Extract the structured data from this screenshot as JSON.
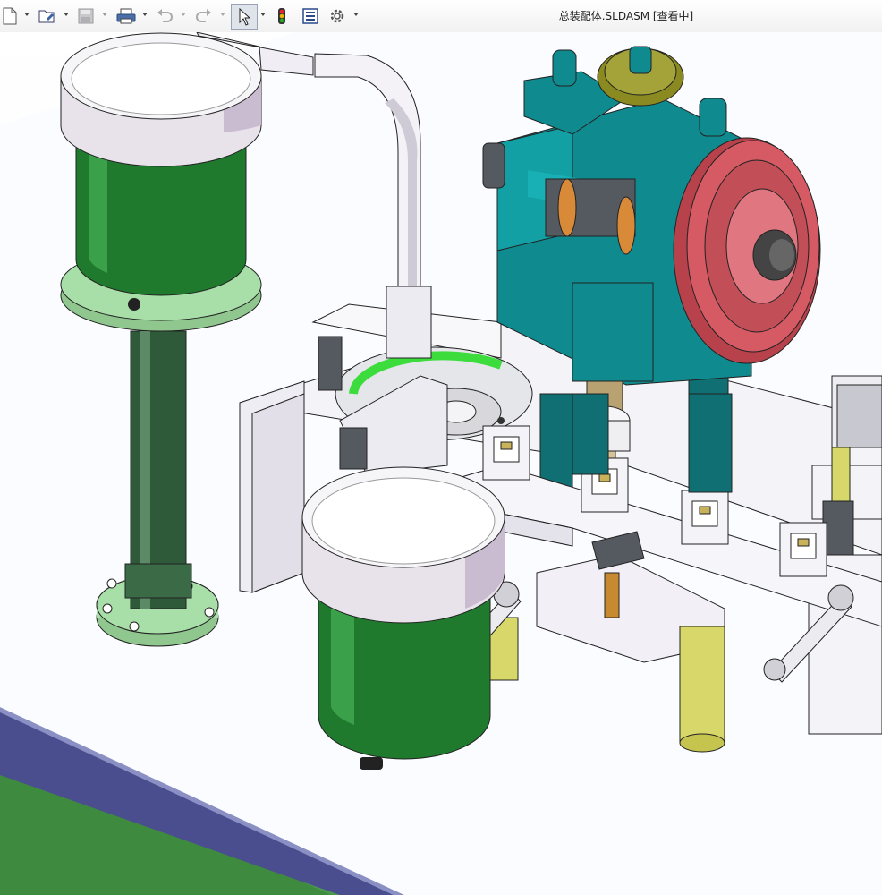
{
  "window": {
    "title": "总装配体.SLDASM [查看中]"
  },
  "toolbar": {
    "items": [
      {
        "name": "new-document",
        "icon": "new-document-icon",
        "has_dropdown": true
      },
      {
        "name": "open",
        "icon": "open-folder-icon",
        "has_dropdown": true
      },
      {
        "name": "save",
        "icon": "save-icon",
        "has_dropdown": true,
        "disabled": true
      },
      {
        "name": "print",
        "icon": "print-icon",
        "has_dropdown": true
      },
      {
        "name": "undo",
        "icon": "undo-icon",
        "has_dropdown": true,
        "disabled": true
      },
      {
        "name": "redo",
        "icon": "redo-icon",
        "has_dropdown": true,
        "disabled": true
      },
      {
        "name": "select",
        "icon": "select-pointer-icon",
        "has_dropdown": true,
        "active": true
      },
      {
        "name": "rebuild",
        "icon": "traffic-light-icon",
        "has_dropdown": false
      },
      {
        "name": "file-properties",
        "icon": "file-properties-icon",
        "has_dropdown": false
      },
      {
        "name": "options",
        "icon": "gear-icon",
        "has_dropdown": true
      }
    ]
  },
  "heads_up_toolbar": {
    "items": [
      "zoom-to-fit-icon",
      "zoom-to-area-icon",
      "previous-view-icon",
      "section-view-icon",
      "view-orientation-icon",
      "display-style-icon",
      "hide-show-items-icon",
      "edit-appearance-icon",
      "apply-scene-icon",
      "view-settings-icon"
    ]
  },
  "colors": {
    "hopper_green": "#1f7a2e",
    "hopper_rim": "#e8e2ea",
    "base_plate": "#a8dfa8",
    "frame_white": "#f4f4f8",
    "gearbox_teal": "#0f8a8e",
    "pulley_red": "#d55a63",
    "gear_olive": "#8a8a20",
    "cylinder_yellow": "#d8d86a",
    "table_edge_blue": "#4a4e8e",
    "floor_green": "#3e8a3e"
  }
}
